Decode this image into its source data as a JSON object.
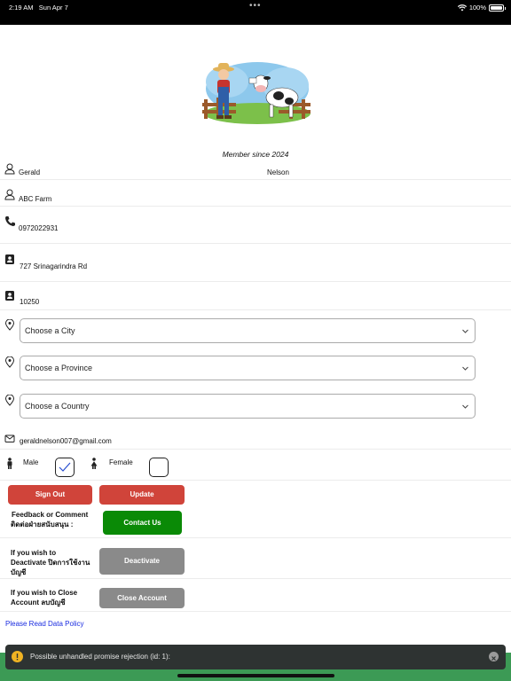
{
  "status_bar": {
    "time": "2:19 AM",
    "date": "Sun Apr 7",
    "battery": "100%",
    "battery_level": 1.0
  },
  "profile": {
    "member_since": "Member since 2024",
    "first_name": "Gerald",
    "last_name": "Nelson",
    "farm_name": "ABC Farm",
    "phone": "0972022931",
    "address": "727 Srinagarindra Rd",
    "postal_code": "10250",
    "email": "geraldnelson007@gmail.com"
  },
  "selects": {
    "city": "Choose a City",
    "province": "Choose a Province",
    "country": "Choose a Country"
  },
  "gender": {
    "male_label": "Male",
    "female_label": "Female",
    "male_checked": true,
    "female_checked": false
  },
  "buttons": {
    "sign_out": "Sign Out",
    "update": "Update",
    "contact_us": "Contact Us",
    "deactivate": "Deactivate",
    "close_account": "Close Account"
  },
  "labels": {
    "feedback_line1": "Feedback or Comment",
    "feedback_line2": "ติดต่อฝ่ายสนับสนุน :",
    "deactivate_line1": "If you wish to",
    "deactivate_line2": "Deactivate  ปิดการใช้งาน",
    "deactivate_line3": "บัญชี",
    "close_line1": "If you wish to Close",
    "close_line2": "Account  ลบบัญชี"
  },
  "links": {
    "data_policy": "Please Read Data Policy"
  },
  "toast": {
    "message": "Possible unhandled promise rejection (id: 1):"
  },
  "colors": {
    "red_button": "#d0443a",
    "green_button": "#0a8a06",
    "gray_button": "#8a8a8a",
    "link": "#1a2ce0",
    "toast_bg": "#2e3332"
  },
  "icons": {
    "name": "person-outline-icon",
    "farm": "person-outline-icon",
    "phone": "phone-icon",
    "address": "contact-card-icon",
    "postal": "contact-card-icon",
    "city": "location-pin-icon",
    "province": "location-pin-icon",
    "country": "location-pin-icon",
    "email": "mail-icon",
    "male": "male-person-icon",
    "female": "female-person-icon"
  }
}
